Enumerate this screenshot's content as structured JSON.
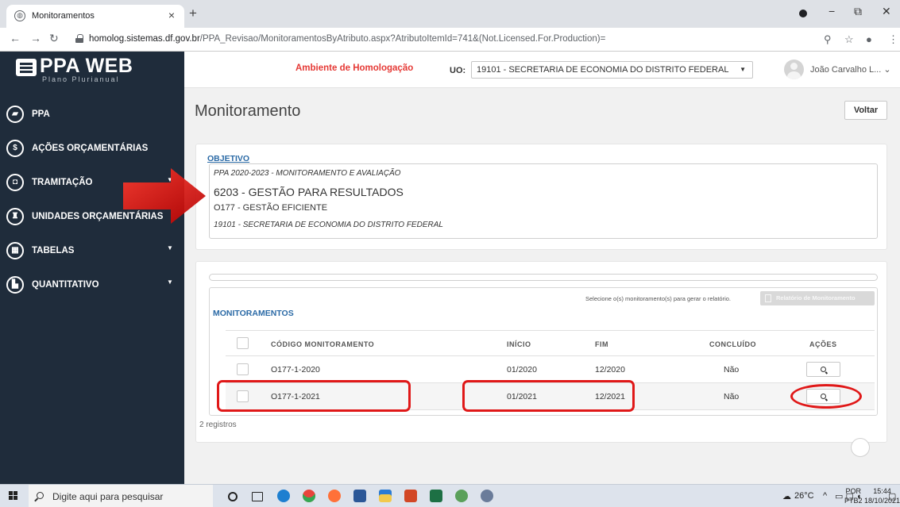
{
  "browser": {
    "tab_title": "Monitoramentos",
    "url_host": "homolog.sistemas.df.gov.br",
    "url_path": "/PPA_Revisao/MonitoramentosByAtributo.aspx?AtributoItemId=741&(Not.Licensed.For.Production)="
  },
  "app": {
    "logo": "PPA WEB",
    "logo_sub": "Plano Plurianual",
    "environment": "Ambiente de Homologação",
    "uo_label": "UO:",
    "uo_value": "19101 - SECRETARIA DE ECONOMIA DO DISTRITO FEDERAL",
    "user_name": "João Carvalho L... ⌄"
  },
  "sidebar": {
    "items": [
      {
        "label": "PPA",
        "icon": "book-icon",
        "glyph": "▰"
      },
      {
        "label": "AÇÕES ORÇAMENTÁRIAS",
        "icon": "dollar-icon",
        "glyph": "$"
      },
      {
        "label": "TRAMITAÇÃO",
        "icon": "inbox-icon",
        "glyph": "◘"
      },
      {
        "label": "UNIDADES ORÇAMENTÁRIAS",
        "icon": "institution-icon",
        "glyph": "♜"
      },
      {
        "label": "TABELAS",
        "icon": "table-icon",
        "glyph": "▦"
      },
      {
        "label": "QUANTITATIVO",
        "icon": "chart-icon",
        "glyph": "▙"
      }
    ]
  },
  "page": {
    "title": "Monitoramento",
    "back_button": "Voltar"
  },
  "objective": {
    "label": "OBJETIVO",
    "ppa": "PPA 2020-2023 - MONITORAMENTO E AVALIAÇÃO",
    "program": "6203 - GESTÃO PARA RESULTADOS",
    "objective": "O177 - GESTÃO EFICIENTE",
    "unit": "19101 - SECRETARIA DE ECONOMIA DO DISTRITO FEDERAL"
  },
  "monitoring": {
    "select_hint": "Selecione o(s) monitoramento(s) para gerar o relatório.",
    "report_button": "Relatório de Monitoramento",
    "section_label": "MONITORAMENTOS",
    "columns": {
      "code": "CÓDIGO MONITORAMENTO",
      "start": "INÍCIO",
      "end": "FIM",
      "done": "CONCLUÍDO",
      "actions": "AÇÕES"
    },
    "rows": [
      {
        "code": "O177-1-2020",
        "start": "01/2020",
        "end": "12/2020",
        "done": "Não"
      },
      {
        "code": "O177-1-2021",
        "start": "01/2021",
        "end": "12/2021",
        "done": "Não"
      }
    ],
    "count": "2 registros"
  },
  "taskbar": {
    "search_placeholder": "Digite aqui para pesquisar",
    "weather": "26°C",
    "lang": "POR",
    "lang2": "PTB2",
    "time": "15:44",
    "date": "18/10/2021"
  }
}
